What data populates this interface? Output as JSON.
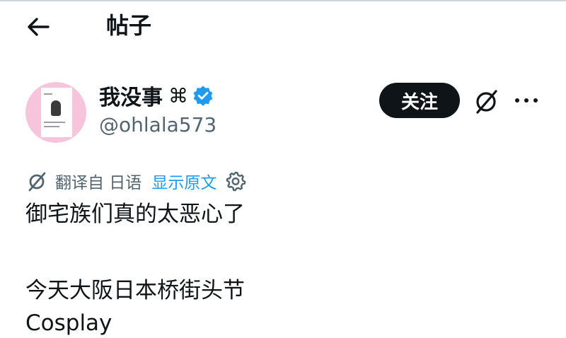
{
  "header": {
    "title": "帖子",
    "back_icon": "arrow-left-icon"
  },
  "author": {
    "name": "我没事",
    "name_symbol": "⌘",
    "handle": "@ohlala573",
    "verified_icon": "verified-badge-icon",
    "verified_color": "#1d9bf0"
  },
  "actions": {
    "follow_label": "关注",
    "grok_icon": "grok-icon",
    "more_icon": "more-horizontal-icon"
  },
  "translation": {
    "translated_from": "翻译自 日语",
    "show_original": "显示原文",
    "link_color": "#1d9bf0"
  },
  "post": {
    "lines": [
      "御宅族们真的太恶心了",
      "今天大阪日本桥街头节",
      "Cosplay"
    ]
  }
}
